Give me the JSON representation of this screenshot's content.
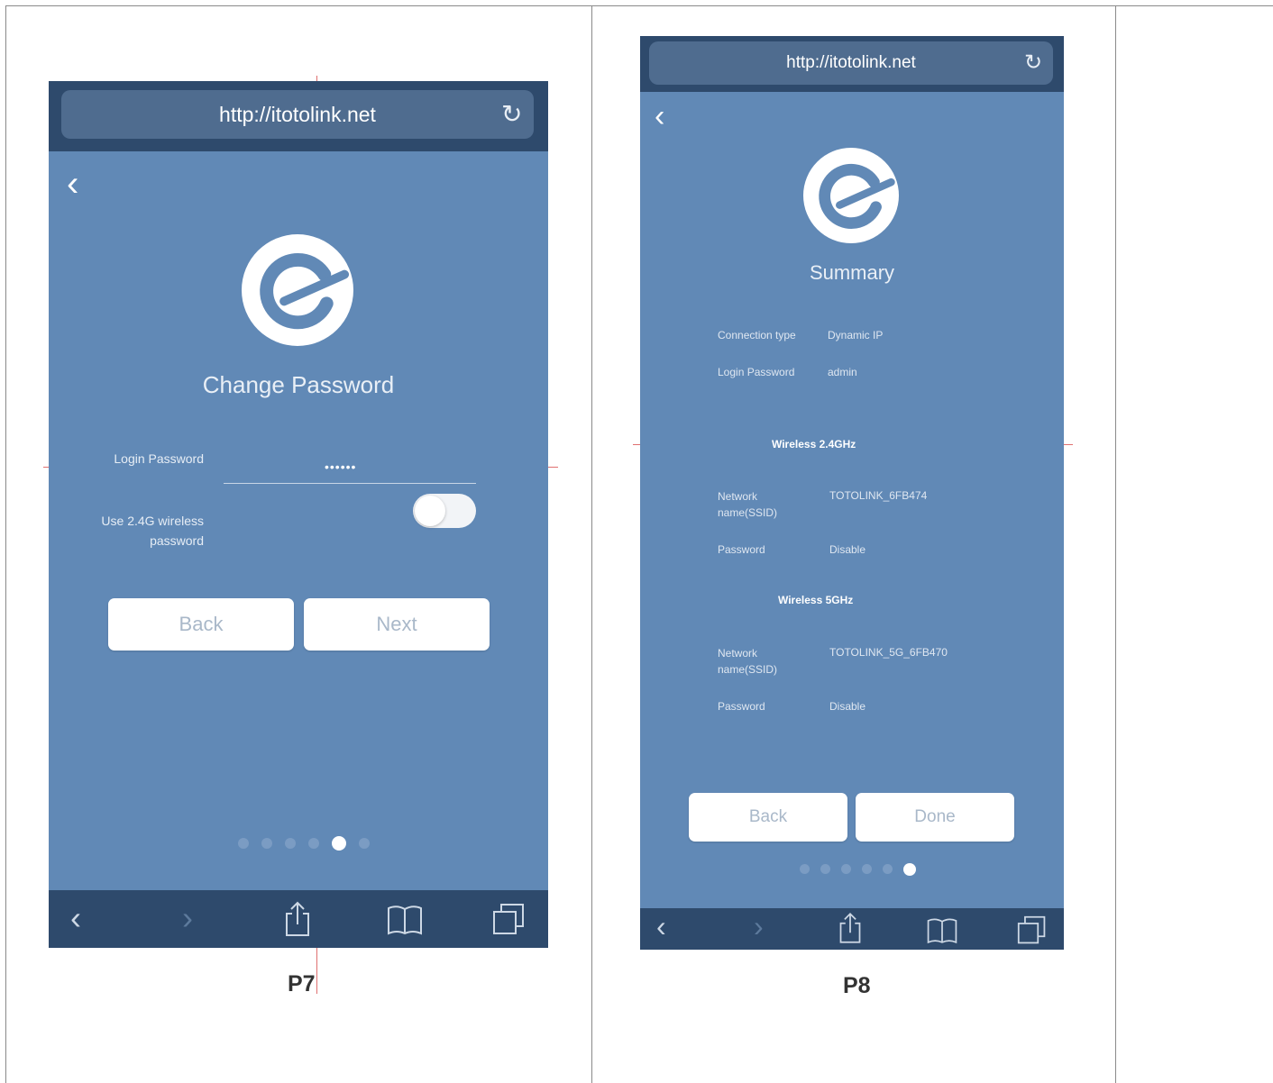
{
  "panel_left": {
    "caption": "P7",
    "url": "http://itotolink.net",
    "title": "Change Password",
    "login_password_label": "Login Password",
    "login_password_value": "••••••",
    "use_24g_label": "Use 2.4G wireless\npassword",
    "back_button": "Back",
    "next_button": "Next",
    "dots_total": 6,
    "active_dot": 5
  },
  "panel_right": {
    "caption": "P8",
    "url": "http://itotolink.net",
    "title": "Summary",
    "connection_type_label": "Connection type",
    "connection_type_value": "Dynamic IP",
    "login_password_label": "Login Password",
    "login_password_value": "admin",
    "wireless_24_heading": "Wireless 2.4GHz",
    "network_name_label_24": "Network\nname(SSID)",
    "network_name_value_24": "TOTOLINK_6FB474",
    "password_label_24": "Password",
    "password_value_24": "Disable",
    "wireless_5_heading": "Wireless 5GHz",
    "network_name_label_5": "Network\nname(SSID)",
    "network_name_value_5": "TOTOLINK_5G_6FB470",
    "password_label_5": "Password",
    "password_value_5": "Disable",
    "back_button": "Back",
    "done_button": "Done",
    "dots_total": 6,
    "active_dot": 6
  },
  "colors": {
    "screen_bg": "#6189b6",
    "bar_bg": "#2e4a6c",
    "button_text": "#a9b8c9"
  },
  "icons": {
    "refresh": "refresh-icon",
    "back": "chevron-left-icon",
    "share": "share-icon",
    "bookmarks": "book-icon",
    "tabs": "tabs-icon"
  }
}
